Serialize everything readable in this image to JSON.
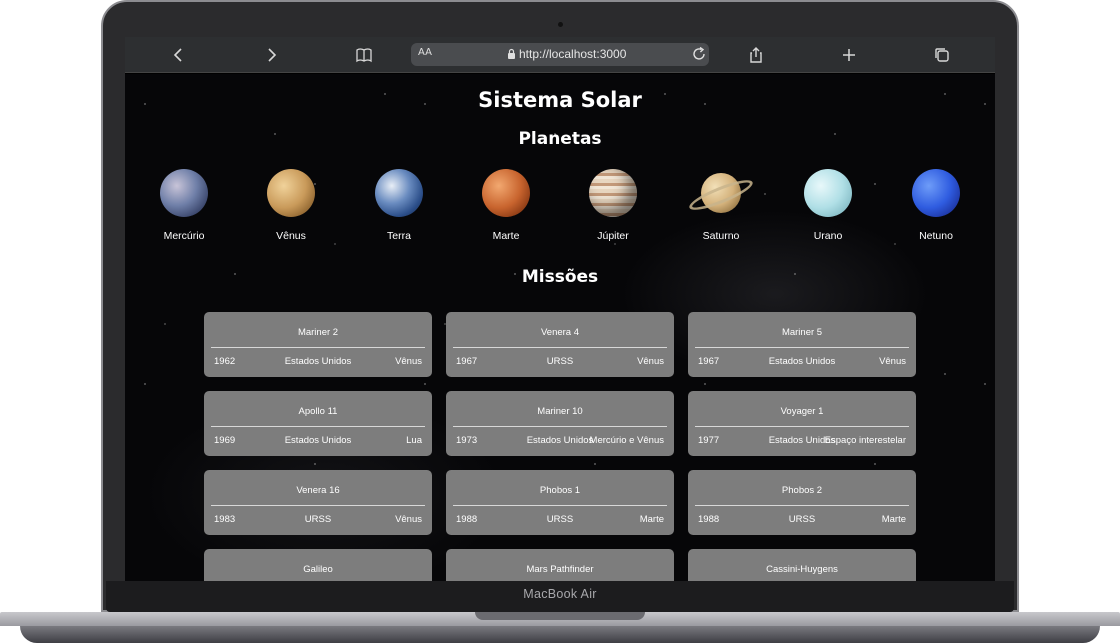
{
  "browser": {
    "text_size_label": "AA",
    "url": "http://localhost:3000"
  },
  "device": {
    "label": "MacBook Air"
  },
  "page": {
    "title": "Sistema Solar",
    "planets_heading": "Planetas",
    "missions_heading": "Missões"
  },
  "planets": [
    {
      "name": "Mercúrio"
    },
    {
      "name": "Vênus"
    },
    {
      "name": "Terra"
    },
    {
      "name": "Marte"
    },
    {
      "name": "Júpiter"
    },
    {
      "name": "Saturno"
    },
    {
      "name": "Urano"
    },
    {
      "name": "Netuno"
    }
  ],
  "missions": [
    {
      "name": "Mariner 2",
      "year": "1962",
      "country": "Estados Unidos",
      "target": "Vênus"
    },
    {
      "name": "Venera 4",
      "year": "1967",
      "country": "URSS",
      "target": "Vênus"
    },
    {
      "name": "Mariner 5",
      "year": "1967",
      "country": "Estados Unidos",
      "target": "Vênus"
    },
    {
      "name": "Apollo 11",
      "year": "1969",
      "country": "Estados Unidos",
      "target": "Lua"
    },
    {
      "name": "Mariner 10",
      "year": "1973",
      "country": "Estados Unidos",
      "target": "Mercúrio e Vênus"
    },
    {
      "name": "Voyager 1",
      "year": "1977",
      "country": "Estados Unidos",
      "target": "Espaço interestelar"
    },
    {
      "name": "Venera 16",
      "year": "1983",
      "country": "URSS",
      "target": "Vênus"
    },
    {
      "name": "Phobos 1",
      "year": "1988",
      "country": "URSS",
      "target": "Marte"
    },
    {
      "name": "Phobos 2",
      "year": "1988",
      "country": "URSS",
      "target": "Marte"
    },
    {
      "name": "Galileo",
      "year": "",
      "country": "",
      "target": ""
    },
    {
      "name": "Mars Pathfinder",
      "year": "",
      "country": "",
      "target": ""
    },
    {
      "name": "Cassini-Huygens",
      "year": "",
      "country": "",
      "target": ""
    }
  ]
}
